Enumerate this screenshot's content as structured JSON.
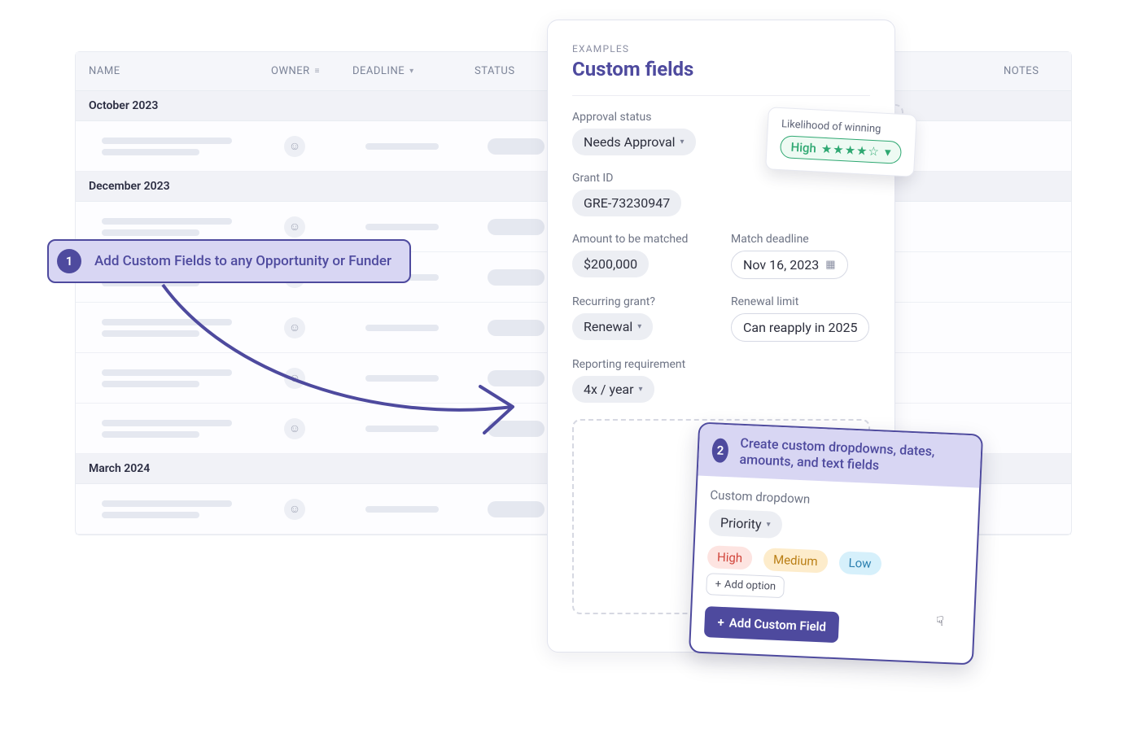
{
  "table": {
    "headers": {
      "name": "NAME",
      "owner": "OWNER",
      "deadline": "DEADLINE",
      "status": "STATUS",
      "notes": "NOTES"
    },
    "groups": [
      "October 2023",
      "December 2023",
      "March 2024"
    ],
    "rowCounts": [
      1,
      5,
      1
    ]
  },
  "tips": {
    "one": {
      "num": "1",
      "text": "Add Custom Fields to any Opportunity or Funder"
    },
    "two": {
      "num": "2",
      "text": "Create custom dropdowns, dates, amounts, and text fields"
    }
  },
  "panel": {
    "eyebrow": "EXAMPLES",
    "title": "Custom fields",
    "approval": {
      "label": "Approval status",
      "value": "Needs Approval"
    },
    "likelihood": {
      "label": "Likelihood of winning",
      "value": "High",
      "stars": "★★★★☆"
    },
    "grant": {
      "label": "Grant ID",
      "value": "GRE-73230947"
    },
    "amount": {
      "label": "Amount to be matched",
      "value": "$200,000"
    },
    "matchDeadline": {
      "label": "Match deadline",
      "value": "Nov 16, 2023"
    },
    "recurring": {
      "label": "Recurring grant?",
      "value": "Renewal"
    },
    "renewal": {
      "label": "Renewal limit",
      "value": "Can reapply in 2025"
    },
    "reporting": {
      "label": "Reporting requirement",
      "value": "4x / year"
    }
  },
  "dropdownEditor": {
    "label": "Custom dropdown",
    "name": "Priority",
    "options": {
      "high": "High",
      "medium": "Medium",
      "low": "Low"
    },
    "addOption": "Add option",
    "addField": "Add Custom Field"
  }
}
